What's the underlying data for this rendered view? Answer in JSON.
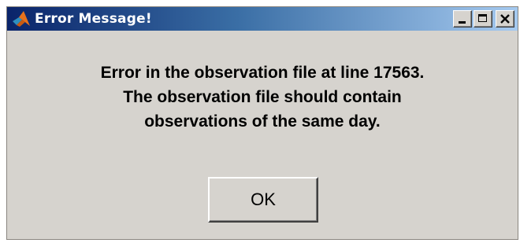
{
  "window": {
    "title": "Error Message!",
    "icon": "matlab-logo-icon"
  },
  "title_buttons": {
    "minimize": "minimize-icon",
    "maximize": "maximize-icon",
    "close": "close-icon"
  },
  "message": {
    "lines": [
      "Error in the observation file at line 17563.",
      "The observation file should contain",
      "observations of the same day."
    ]
  },
  "buttons": {
    "ok_label": "OK"
  },
  "colors": {
    "titlebar_start": "#0a246a",
    "titlebar_end": "#a6caf0",
    "dialog_bg": "#d6d3ce"
  }
}
